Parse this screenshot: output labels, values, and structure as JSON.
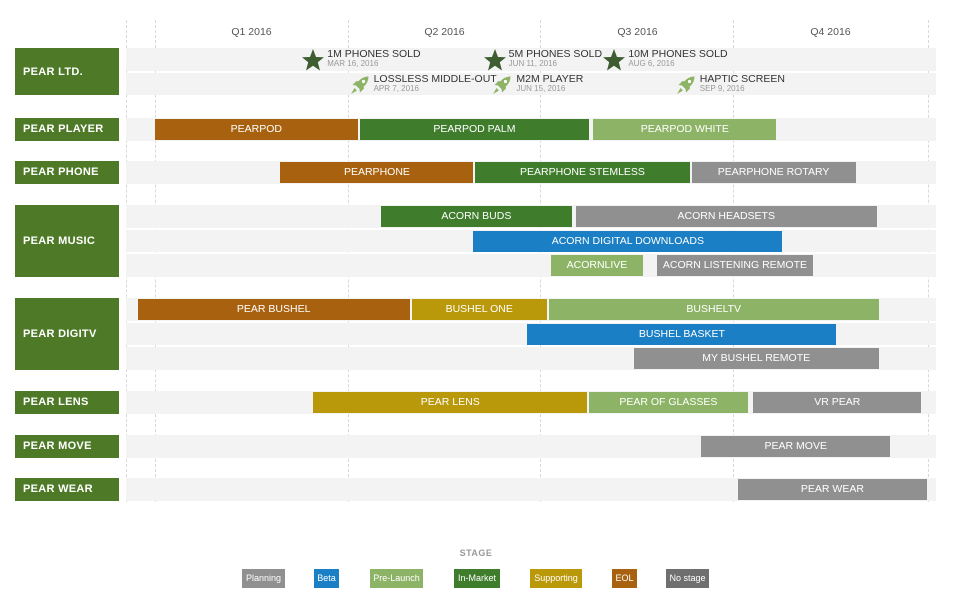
{
  "quarters": [
    "Q1 2016",
    "Q2 2016",
    "Q3 2016",
    "Q4 2016"
  ],
  "colors": {
    "lane_bg": "#4e7a28",
    "planning": "#909090",
    "beta": "#1a7fc4",
    "prelaunch": "#8db466",
    "inmarket": "#3f7d2d",
    "supporting": "#b9980a",
    "eol": "#a8610e",
    "nostage": "#6f6f6f",
    "star_icon": "#3e5e31",
    "rocket_icon": "#8db466"
  },
  "lanes": [
    {
      "label": "PEAR LTD.",
      "milestones": [
        {
          "icon": "star-icon",
          "label": "1M PHONES SOLD",
          "date": "MAR 16, 2016",
          "quarter_pos": 0.82,
          "line": 0
        },
        {
          "icon": "star-icon",
          "label": "5M PHONES SOLD",
          "date": "JUN 11, 2016",
          "quarter_pos": 1.76,
          "line": 0
        },
        {
          "icon": "star-icon",
          "label": "10M PHONES SOLD",
          "date": "AUG 6, 2016",
          "quarter_pos": 2.38,
          "line": 0
        },
        {
          "icon": "rocket-icon",
          "label": "LOSSLESS MIDDLE-OUT",
          "date": "APR 7, 2016",
          "quarter_pos": 1.06,
          "line": 1
        },
        {
          "icon": "rocket-icon",
          "label": "M2M PLAYER",
          "date": "JUN 15, 2016",
          "quarter_pos": 1.8,
          "line": 1
        },
        {
          "icon": "rocket-icon",
          "label": "HAPTIC SCREEN",
          "date": "SEP 9, 2016",
          "quarter_pos": 2.75,
          "line": 1
        }
      ]
    },
    {
      "label": "PEAR PLAYER",
      "bars": [
        {
          "label": "PEARPOD",
          "stage": "eol",
          "start": 0.0,
          "end": 1.05,
          "line": 0
        },
        {
          "label": "PEARPOD PALM",
          "stage": "inmarket",
          "start": 1.06,
          "end": 2.25,
          "line": 0
        },
        {
          "label": "PEARPOD WHITE",
          "stage": "prelaunch",
          "start": 2.27,
          "end": 3.22,
          "line": 0
        }
      ]
    },
    {
      "label": "PEAR PHONE",
      "bars": [
        {
          "label": "PEARPHONE",
          "stage": "eol",
          "start": 0.65,
          "end": 1.65,
          "line": 0
        },
        {
          "label": "PEARPHONE STEMLESS",
          "stage": "inmarket",
          "start": 1.66,
          "end": 2.77,
          "line": 0
        },
        {
          "label": "PEARPHONE ROTARY",
          "stage": "planning",
          "start": 2.78,
          "end": 3.63,
          "line": 0
        }
      ]
    },
    {
      "label": "PEAR MUSIC",
      "bars": [
        {
          "label": "ACORN BUDS",
          "stage": "inmarket",
          "start": 1.17,
          "end": 2.16,
          "line": 0
        },
        {
          "label": "ACORN HEADSETS",
          "stage": "planning",
          "start": 2.18,
          "end": 3.74,
          "line": 0
        },
        {
          "label": "ACORN DIGITAL DOWNLOADS",
          "stage": "beta",
          "start": 1.65,
          "end": 3.25,
          "line": 1
        },
        {
          "label": "ACORNLIVE",
          "stage": "prelaunch",
          "start": 2.05,
          "end": 2.53,
          "line": 2
        },
        {
          "label": "ACORN LISTENING REMOTE",
          "stage": "planning",
          "start": 2.6,
          "end": 3.41,
          "line": 2
        }
      ]
    },
    {
      "label": "PEAR DIGITV",
      "bars": [
        {
          "label": "PEAR BUSHEL",
          "stage": "eol",
          "start": -0.09,
          "end": 1.32,
          "line": 0
        },
        {
          "label": "BUSHEL ONE",
          "stage": "supporting",
          "start": 1.33,
          "end": 2.03,
          "line": 0
        },
        {
          "label": "BUSHELTV",
          "stage": "prelaunch",
          "start": 2.04,
          "end": 3.75,
          "line": 0
        },
        {
          "label": "BUSHEL BASKET",
          "stage": "beta",
          "start": 1.93,
          "end": 3.53,
          "line": 1
        },
        {
          "label": "MY BUSHEL REMOTE",
          "stage": "planning",
          "start": 2.48,
          "end": 3.75,
          "line": 2
        }
      ]
    },
    {
      "label": "PEAR LENS",
      "bars": [
        {
          "label": "PEAR LENS",
          "stage": "supporting",
          "start": 0.82,
          "end": 2.24,
          "line": 0
        },
        {
          "label": "PEAR OF GLASSES",
          "stage": "prelaunch",
          "start": 2.25,
          "end": 3.07,
          "line": 0
        },
        {
          "label": "VR PEAR",
          "stage": "planning",
          "start": 3.1,
          "end": 3.97,
          "line": 0
        }
      ]
    },
    {
      "label": "PEAR MOVE",
      "bars": [
        {
          "label": "PEAR MOVE",
          "stage": "planning",
          "start": 2.83,
          "end": 3.81,
          "line": 0
        }
      ]
    },
    {
      "label": "PEAR WEAR",
      "bars": [
        {
          "label": "PEAR WEAR",
          "stage": "planning",
          "start": 3.02,
          "end": 4.0,
          "line": 0
        }
      ]
    }
  ],
  "legend": {
    "title": "STAGE",
    "items": [
      {
        "label": "Planning",
        "stage": "planning"
      },
      {
        "label": "Beta",
        "stage": "beta"
      },
      {
        "label": "Pre-Launch",
        "stage": "prelaunch"
      },
      {
        "label": "In-Market",
        "stage": "inmarket"
      },
      {
        "label": "Supporting",
        "stage": "supporting"
      },
      {
        "label": "EOL",
        "stage": "eol"
      },
      {
        "label": "No stage",
        "stage": "nostage"
      }
    ]
  }
}
